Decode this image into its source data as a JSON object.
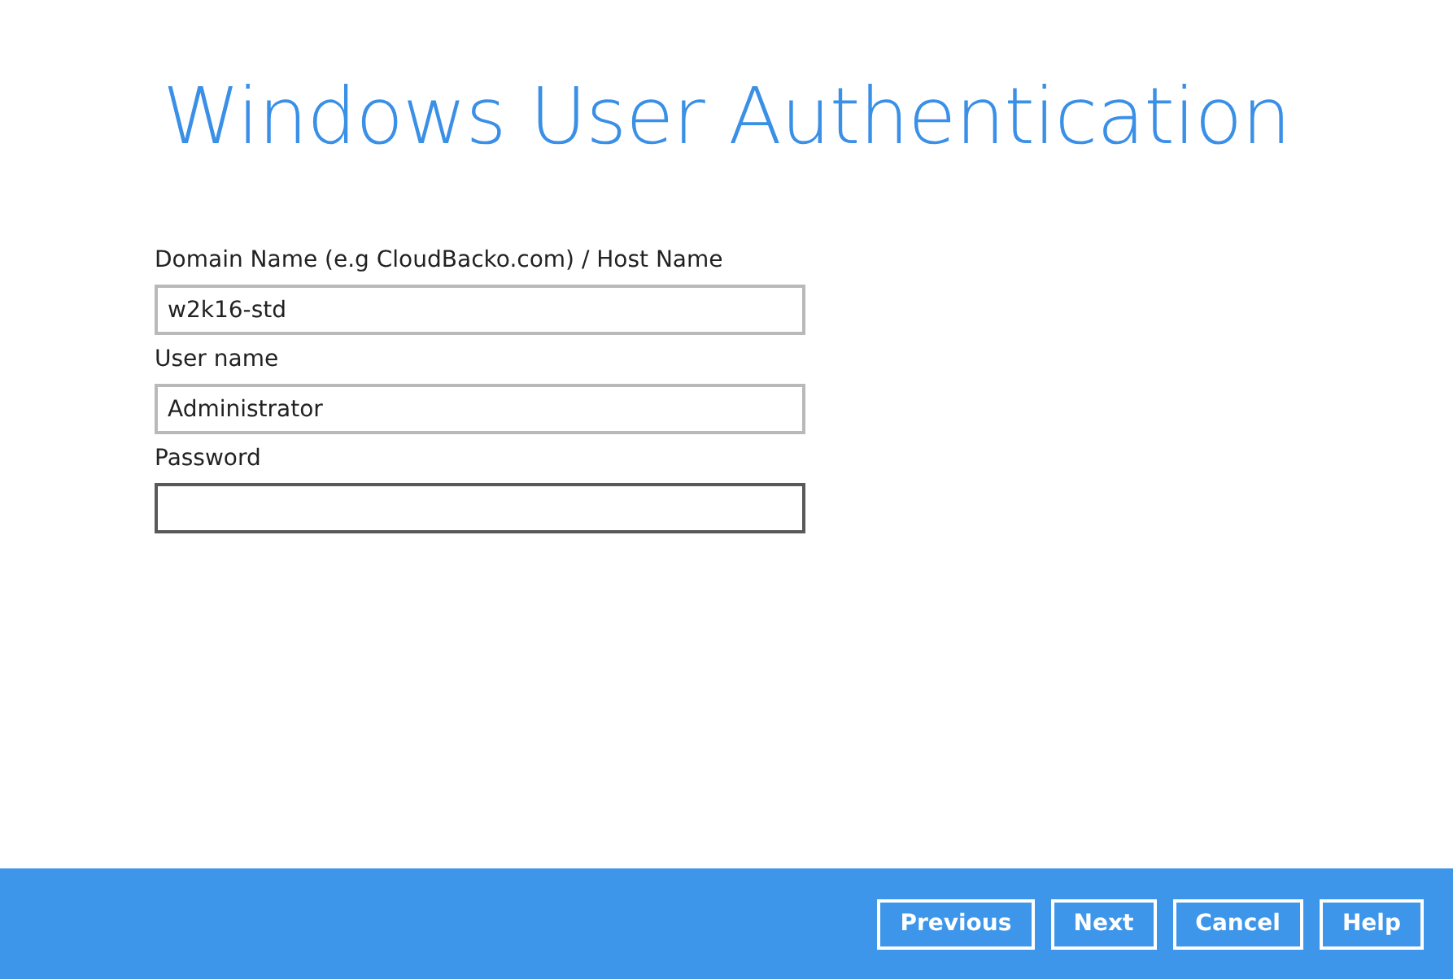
{
  "title": "Windows User Authentication",
  "fields": [
    {
      "label": "Domain Name (e.g CloudBacko.com) / Host Name",
      "value": "w2k16-std",
      "focused": false
    },
    {
      "label": "User name",
      "value": "Administrator",
      "focused": false
    },
    {
      "label": "Password",
      "focused": true
    }
  ],
  "buttons": [
    "Previous",
    "Next",
    "Cancel",
    "Help"
  ]
}
